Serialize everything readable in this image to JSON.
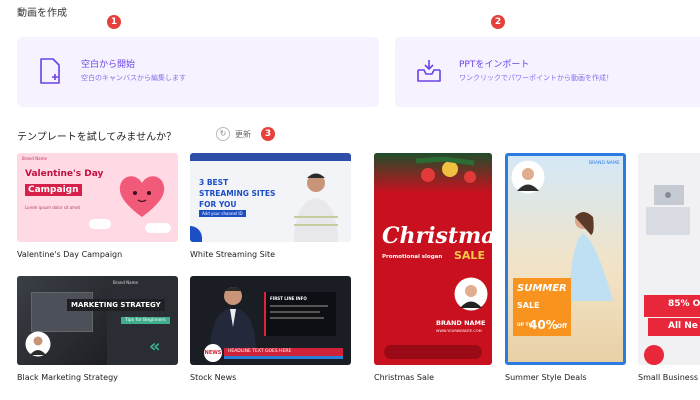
{
  "header": {
    "title": "動画を作成"
  },
  "markers": [
    "1",
    "2",
    "3"
  ],
  "create_cards": [
    {
      "title": "空白から開始",
      "subtitle": "空白のキャンバスから編集します",
      "icon": "blank-file-plus-icon"
    },
    {
      "title": "PPTをインポート",
      "subtitle": "ワンクリックでパワーポイントから動画を作成！",
      "icon": "import-tray-icon"
    }
  ],
  "templates_section": {
    "title": "テンプレートを試してみませんか？",
    "refresh_label": "更新"
  },
  "templates": [
    {
      "caption": "Valentine's Day Campaign",
      "brand": "Brand Name",
      "headline": "Valentine's Day",
      "headline2": "Campaign",
      "sub": "Lorem ipsum dolor sit amet"
    },
    {
      "caption": "White Streaming Site",
      "headline": "3 BEST STREAMING SITES FOR YOU",
      "button": "Add your channel ID"
    },
    {
      "caption": "Black Marketing Strategy",
      "brand": "Brand Name",
      "headline": "MARKETING STRATEGY",
      "sub": "Tips for Beginners"
    },
    {
      "caption": "Stock News",
      "badge": "NEWS",
      "info": "FIRST LINE INFO",
      "headline": "HEADLINE TEXT GOES HERE"
    },
    {
      "caption": "Christmas Sale",
      "headline": "Christmas",
      "sub": "Promotional slogan",
      "sale": "SALE",
      "brand": "BRAND NAME",
      "site": "WWW.YOURWEBSITE.COM"
    },
    {
      "caption": "Summer Style Deals",
      "brand": "BRAND NAME",
      "headline": "SUMMER",
      "sale": "SALE",
      "up_to": "UP TO",
      "pct": "40%",
      "off": "Off"
    },
    {
      "caption": "Small Business",
      "pct": "85% O",
      "all": "All Ne"
    }
  ]
}
